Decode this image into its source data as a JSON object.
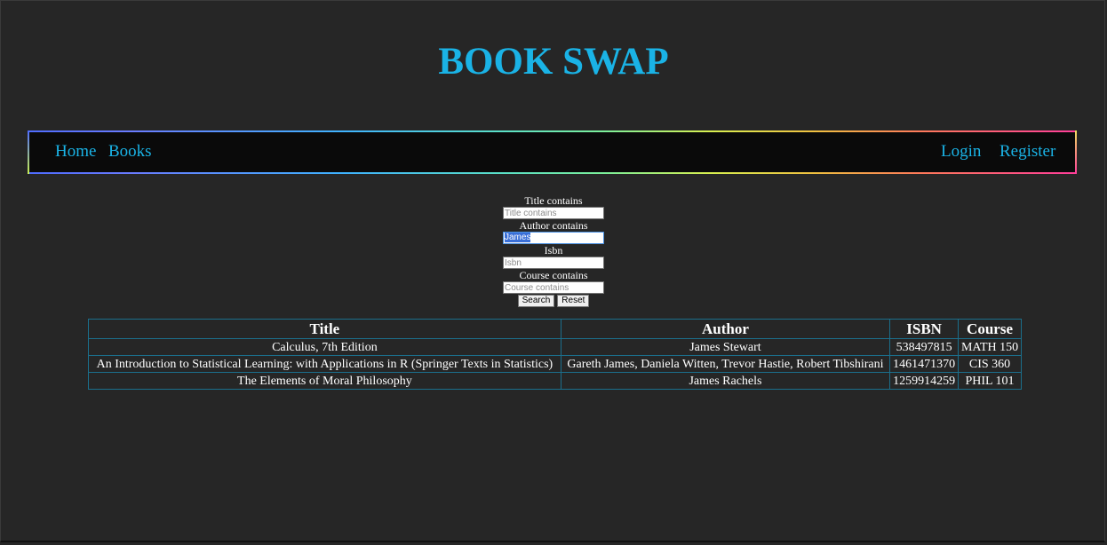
{
  "site": {
    "title": "BOOK SWAP"
  },
  "nav": {
    "home": "Home",
    "books": "Books",
    "login": "Login",
    "register": "Register"
  },
  "search": {
    "title_label": "Title contains",
    "title_placeholder": "Title contains",
    "author_label": "Author contains",
    "author_value": "James",
    "isbn_label": "Isbn",
    "isbn_placeholder": "Isbn",
    "course_label": "Course contains",
    "course_placeholder": "Course contains",
    "search_button": "Search",
    "reset_button": "Reset"
  },
  "table": {
    "headers": [
      "Title",
      "Author",
      "ISBN",
      "Course"
    ],
    "rows": [
      [
        "Calculus, 7th Edition",
        "James Stewart",
        "538497815",
        "MATH 150"
      ],
      [
        "An Introduction to Statistical Learning: with Applications in R (Springer Texts in Statistics)",
        "Gareth James, Daniela Witten, Trevor Hastie, Robert Tibshirani",
        "1461471370",
        "CIS 360"
      ],
      [
        "The Elements of Moral Philosophy",
        "James Rachels",
        "1259914259",
        "PHIL 101"
      ]
    ]
  },
  "colors": {
    "background": "#262626",
    "accent": "#1ab3e6",
    "nav_background": "#0a0a0a",
    "table_border": "#1b6f8c"
  }
}
